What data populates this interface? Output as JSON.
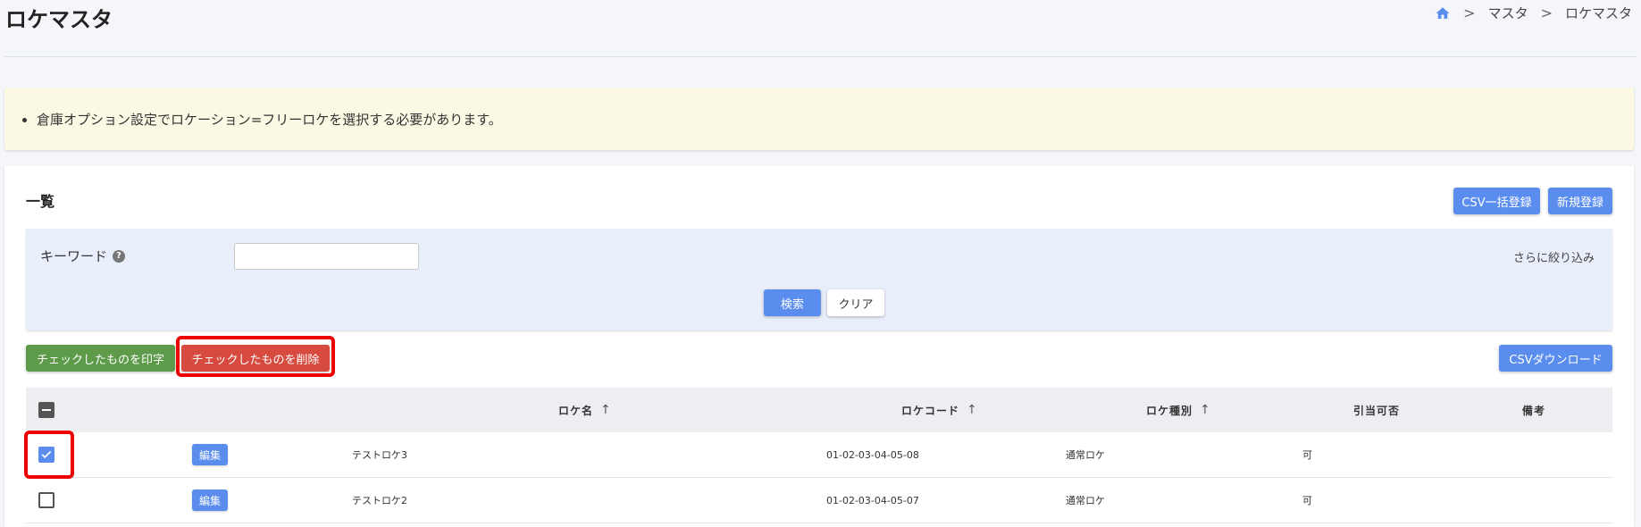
{
  "header": {
    "title": "ロケマスタ",
    "breadcrumb": [
      "マスタ",
      "ロケマスタ"
    ],
    "breadcrumb_sep": ">"
  },
  "notice": {
    "message": "倉庫オプション設定でロケーション=フリーロケを選択する必要があります。"
  },
  "list": {
    "title": "一覧",
    "csv_bulk_label": "CSV一括登録",
    "new_label": "新規登録",
    "filter": {
      "keyword_label": "キーワード",
      "help_glyph": "?",
      "keyword_value": "",
      "keyword_placeholder": "",
      "more_filter_label": "さらに絞り込み",
      "search_label": "検索",
      "clear_label": "クリア"
    },
    "print_checked_label": "チェックしたものを印字",
    "delete_checked_label": "チェックしたものを削除",
    "csv_download_label": "CSVダウンロード",
    "columns": {
      "name": "ロケ名",
      "code": "ロケコード",
      "type": "ロケ種別",
      "allocatable": "引当可否",
      "remarks": "備考"
    },
    "sort_glyph": "↑",
    "edit_label": "編集",
    "rows": [
      {
        "checked": true,
        "name": "テストロケ3",
        "code": "01-02-03-04-05-08",
        "type": "通常ロケ",
        "allocatable": "可",
        "remarks": ""
      },
      {
        "checked": false,
        "name": "テストロケ2",
        "code": "01-02-03-04-05-07",
        "type": "通常ロケ",
        "allocatable": "可",
        "remarks": ""
      }
    ]
  },
  "colors": {
    "primary": "#5b8def",
    "success": "#5d9a49",
    "danger": "#d64a3f",
    "highlight": "#ee0000",
    "notice_bg": "#fbf8e3"
  }
}
